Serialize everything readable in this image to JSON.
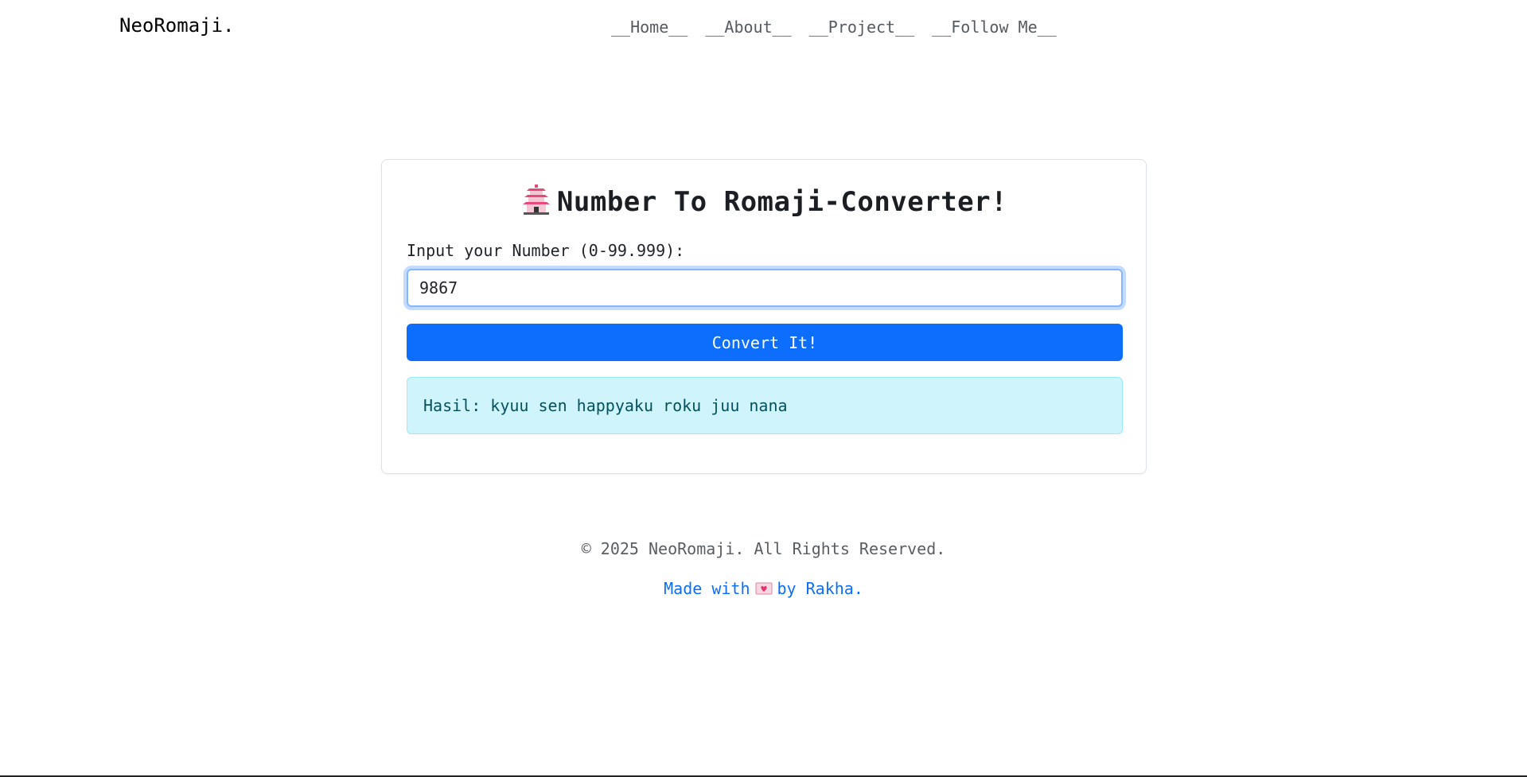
{
  "navbar": {
    "brand": "NeoRomaji.",
    "links": [
      "__Home__",
      "__About__",
      "__Project__",
      "__Follow Me__"
    ]
  },
  "converter": {
    "title_icon": "pagoda-icon",
    "title": "Number To Romaji-Converter!",
    "input_label": "Input your Number (0-99.999):",
    "input_value": "9867",
    "button_label": "Convert It!",
    "result_text": "Hasil: kyuu sen happyaku roku juu nana"
  },
  "footer": {
    "copyright": "© 2025 NeoRomaji. All Rights Reserved.",
    "made_prefix": "Made with",
    "made_icon": "heart-letter-icon",
    "made_suffix": "by Rakha."
  },
  "colors": {
    "primary": "#0d6efd",
    "result_bg": "#cff4fc",
    "result_text": "#055160"
  }
}
